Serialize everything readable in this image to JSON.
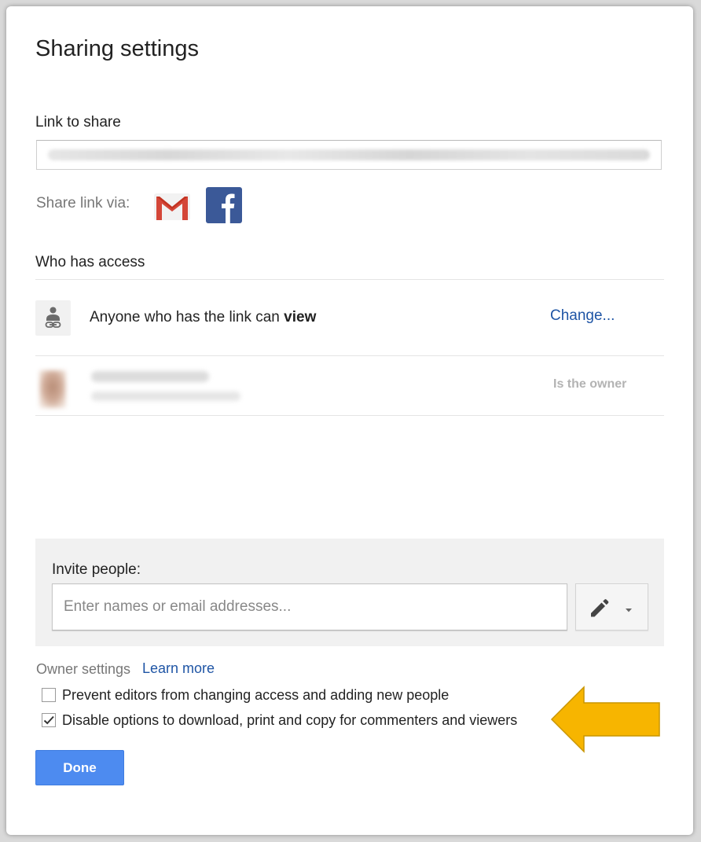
{
  "dialog": {
    "title": "Sharing settings"
  },
  "link": {
    "label": "Link to share"
  },
  "share_via": {
    "label": "Share link via:",
    "gmail_icon": "gmail-icon",
    "facebook_icon": "facebook-icon"
  },
  "access": {
    "heading": "Who has access",
    "link_icon": "link-sharing-icon",
    "description_prefix": "Anyone who has the link can ",
    "description_level": "view",
    "change_label": "Change...",
    "owner_role": "Is the owner"
  },
  "invite": {
    "label": "Invite people:",
    "placeholder": "Enter names or email addresses...",
    "permission_icon": "pencil-icon"
  },
  "owner_settings": {
    "label": "Owner settings",
    "learn_more": "Learn more",
    "options": [
      {
        "label": "Prevent editors from changing access and adding new people",
        "checked": false
      },
      {
        "label": "Disable options to download, print and copy for commenters and viewers",
        "checked": true
      }
    ]
  },
  "footer": {
    "done_label": "Done"
  },
  "colors": {
    "accent_blue": "#4d8bf0",
    "link_blue": "#1f55a5",
    "arrow_yellow": "#f7b500",
    "facebook_blue": "#3b5998",
    "gmail_red": "#d44638"
  }
}
